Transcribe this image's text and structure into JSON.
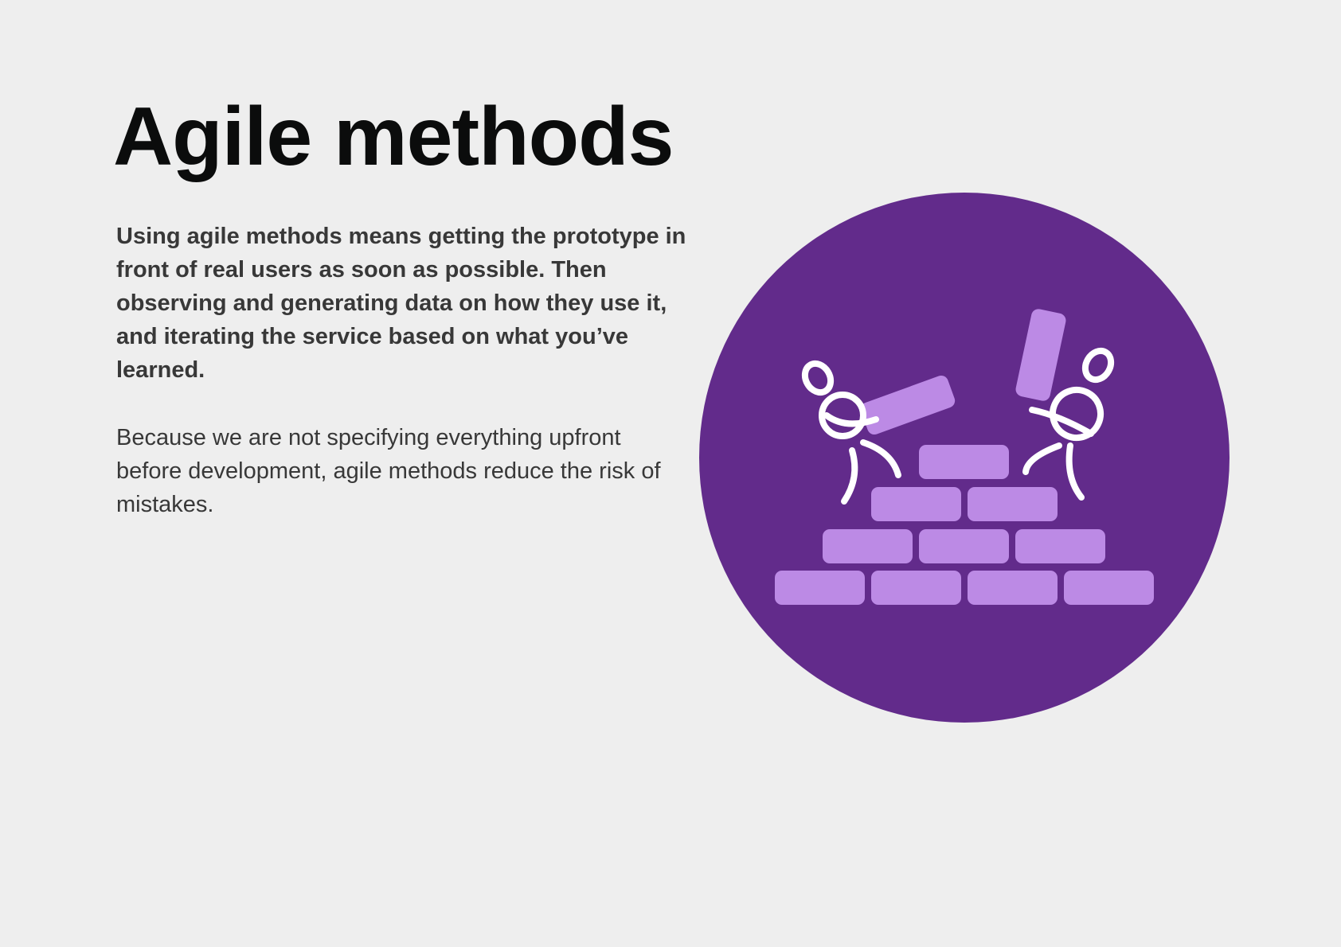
{
  "slide": {
    "title": "Agile methods",
    "lead": "Using agile methods means getting the prototype in front of real users as soon as possible. Then observing and generating data on how they use it, and iterating the service based on what you’ve learned.",
    "body": "Because we are not specifying everything upfront before development, agile methods reduce the risk of mistakes."
  },
  "illustration": {
    "icon": "people-building-brick-wall",
    "colors": {
      "circle": "#622b8b",
      "brick": "#bc8ae5",
      "figure": "#ffffff",
      "background": "#eeeeee",
      "heading": "#0b0c0c",
      "text": "#383838"
    }
  }
}
